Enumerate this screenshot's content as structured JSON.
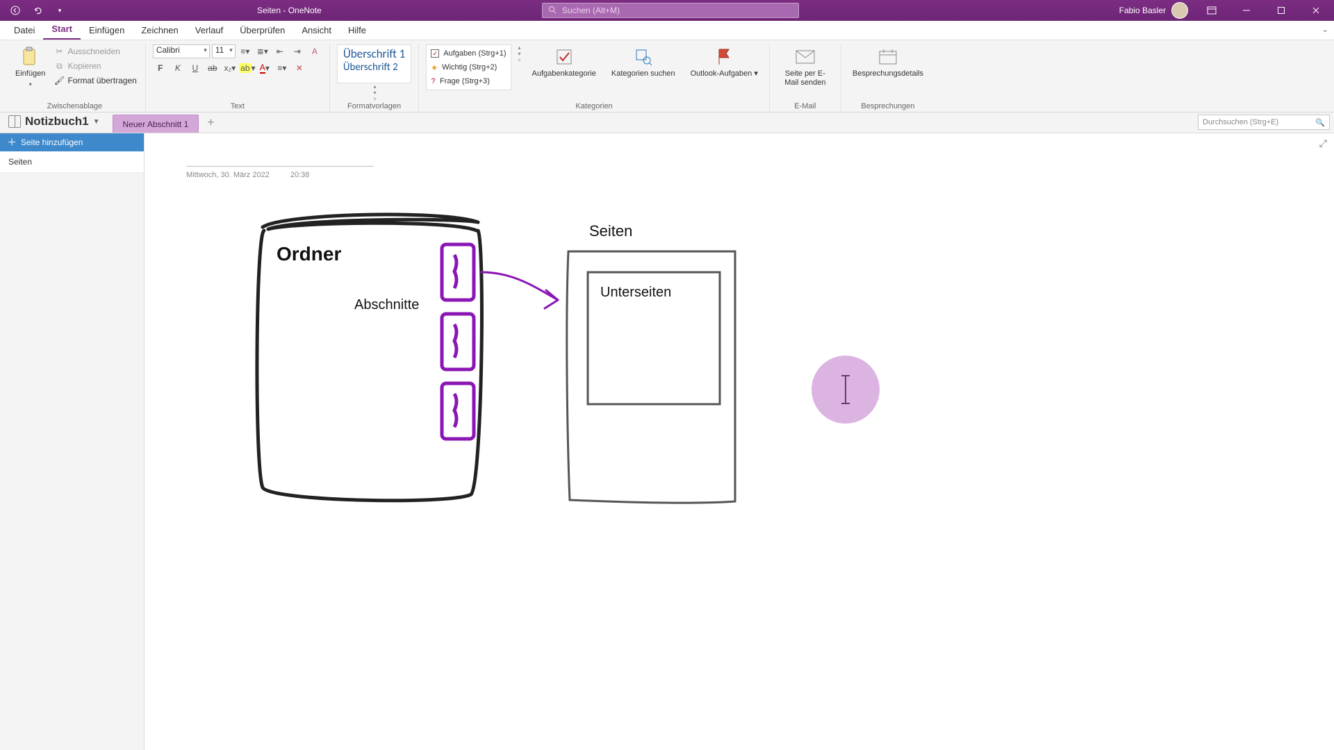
{
  "titlebar": {
    "title": "Seiten  -  OneNote",
    "search_placeholder": "Suchen (Alt+M)",
    "user_name": "Fabio Basler"
  },
  "menu": {
    "items": [
      "Datei",
      "Start",
      "Einfügen",
      "Zeichnen",
      "Verlauf",
      "Überprüfen",
      "Ansicht",
      "Hilfe"
    ],
    "active_index": 1
  },
  "ribbon": {
    "clipboard": {
      "paste": "Einfügen",
      "cut": "Ausschneiden",
      "copy": "Kopieren",
      "format_painter": "Format übertragen",
      "group": "Zwischenablage"
    },
    "font": {
      "name": "Calibri",
      "size": "11",
      "group": "Text"
    },
    "styles": {
      "h1": "Überschrift 1",
      "h2": "Überschrift 2",
      "group": "Formatvorlagen"
    },
    "tags": {
      "t1": "Aufgaben (Strg+1)",
      "t2": "Wichtig (Strg+2)",
      "t3": "Frage (Strg+3)",
      "btn1": "Aufgabenkategorie",
      "btn2": "Kategorien suchen",
      "btn3": "Outlook-Aufgaben ▾",
      "group": "Kategorien"
    },
    "email": {
      "btn": "Seite per E-Mail senden",
      "group": "E-Mail"
    },
    "meetings": {
      "btn": "Besprechungsdetails",
      "group": "Besprechungen"
    }
  },
  "notebook": {
    "name": "Notizbuch1",
    "section": "Neuer Abschnitt 1",
    "page_search_placeholder": "Durchsuchen (Strg+E)"
  },
  "pagelist": {
    "add": "Seite hinzufügen",
    "pages": [
      "Seiten"
    ]
  },
  "page": {
    "title": "",
    "date": "Mittwoch, 30. März 2022",
    "time": "20:38"
  },
  "drawing": {
    "ordner": "Ordner",
    "abschnitte": "Abschnitte",
    "seiten": "Seiten",
    "unterseiten": "Unterseiten"
  }
}
